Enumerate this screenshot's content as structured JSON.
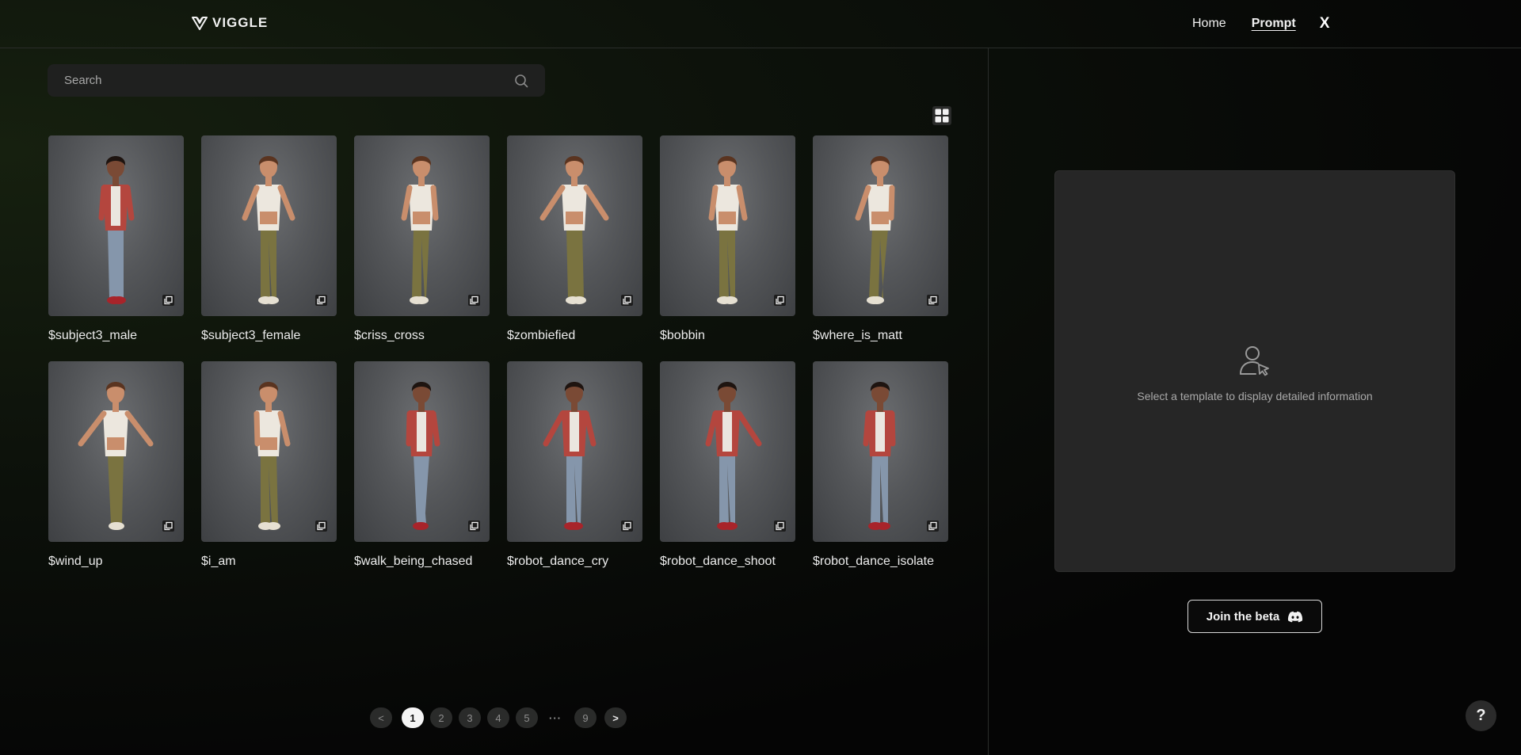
{
  "header": {
    "logo_text": "VIGGLE",
    "nav": [
      {
        "label": "Home",
        "active": false
      },
      {
        "label": "Prompt",
        "active": true
      }
    ],
    "x_label": "X"
  },
  "search": {
    "placeholder": "Search",
    "value": ""
  },
  "templates": [
    {
      "label": "$subject3_male",
      "character": "male"
    },
    {
      "label": "$subject3_female",
      "character": "female"
    },
    {
      "label": "$criss_cross",
      "character": "female"
    },
    {
      "label": "$zombiefied",
      "character": "female"
    },
    {
      "label": "$bobbin",
      "character": "female"
    },
    {
      "label": "$where_is_matt",
      "character": "female"
    },
    {
      "label": "$wind_up",
      "character": "female"
    },
    {
      "label": "$i_am",
      "character": "female"
    },
    {
      "label": "$walk_being_chased",
      "character": "male"
    },
    {
      "label": "$robot_dance_cry",
      "character": "male"
    },
    {
      "label": "$robot_dance_shoot",
      "character": "male"
    },
    {
      "label": "$robot_dance_isolate",
      "character": "male"
    }
  ],
  "pagination": {
    "prev": "<",
    "pages": [
      "1",
      "2",
      "3",
      "4",
      "5"
    ],
    "ellipsis": "···",
    "last": "9",
    "next": ">",
    "current": "1"
  },
  "detail": {
    "empty_text": "Select a template to display detailed information"
  },
  "beta_button": {
    "label": "Join the beta"
  },
  "help_button": {
    "label": "?"
  },
  "colors": {
    "background": "#050505",
    "panel": "#262626",
    "accent_text": "#ffffff"
  }
}
